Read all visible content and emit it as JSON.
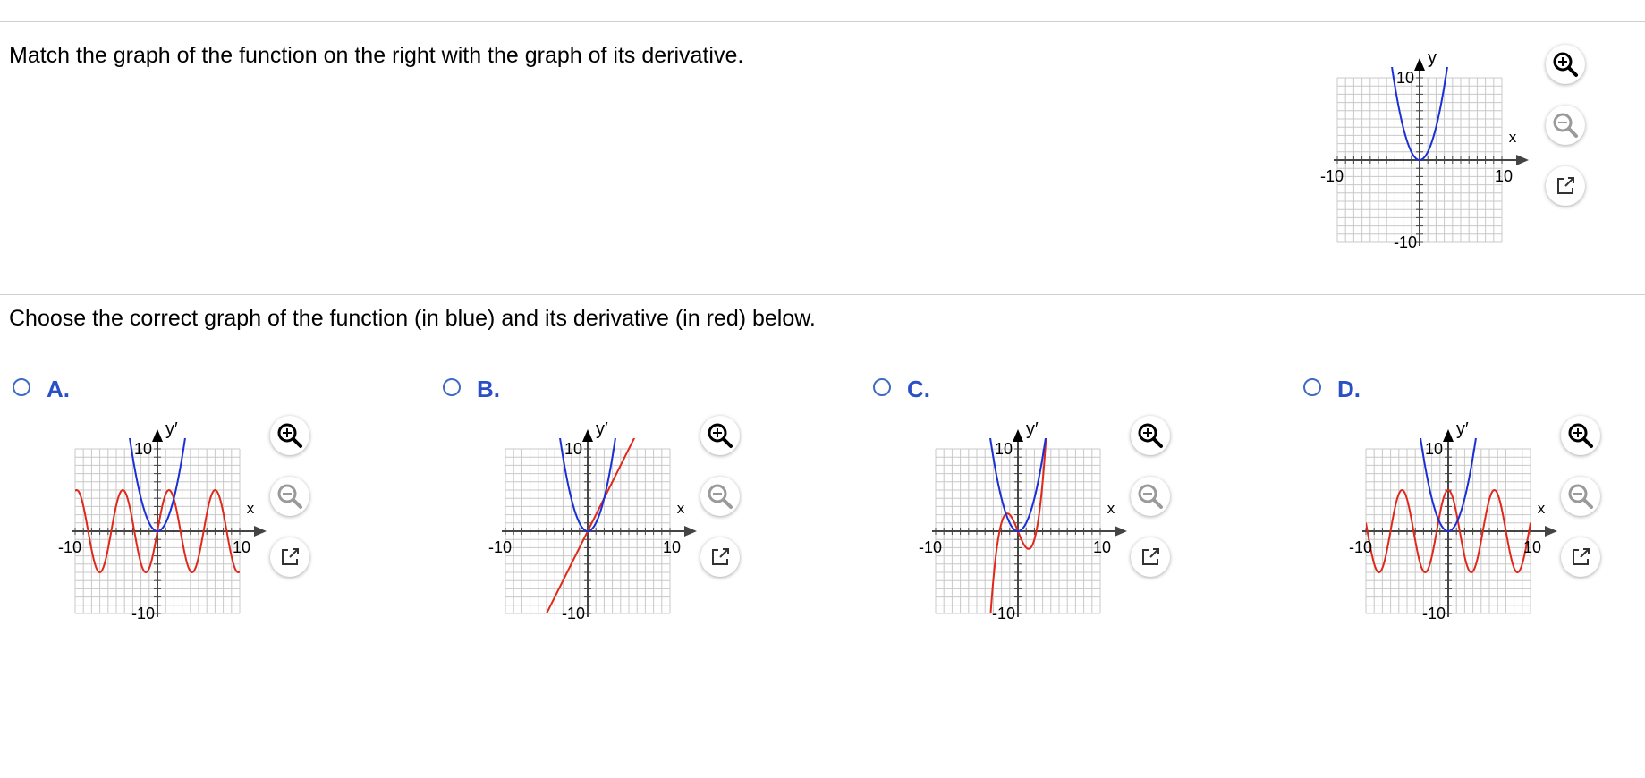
{
  "question": {
    "prompt": "Match the graph of the function on the right with the graph of its derivative.",
    "instruction": "Choose the correct graph of the function (in blue) and its derivative (in red) below."
  },
  "colors": {
    "function": "#1a2fd6",
    "derivative": "#e0281b",
    "option_label": "#2b4fc7",
    "grid": "#c8c8c8"
  },
  "main_graph": {
    "x_label": "x",
    "y_label": "y",
    "x_min_label": "-10",
    "x_max_label": "10",
    "y_max_label": "10",
    "y_min_label": "-10"
  },
  "options": [
    {
      "label": "A.",
      "y_label": "y′",
      "x_label": "x",
      "x_min_label": "-10",
      "x_max_label": "10",
      "y_max_label": "10",
      "y_min_label": "-10",
      "derivative_shape": "sine-wave"
    },
    {
      "label": "B.",
      "y_label": "y′",
      "x_label": "x",
      "x_min_label": "-10",
      "x_max_label": "10",
      "y_max_label": "10",
      "y_min_label": "-10",
      "derivative_shape": "line"
    },
    {
      "label": "C.",
      "y_label": "y′",
      "x_label": "x",
      "x_min_label": "-10",
      "x_max_label": "10",
      "y_max_label": "10",
      "y_min_label": "-10",
      "derivative_shape": "cubic"
    },
    {
      "label": "D.",
      "y_label": "y′",
      "x_label": "x",
      "x_min_label": "-10",
      "x_max_label": "10",
      "y_max_label": "10",
      "y_min_label": "-10",
      "derivative_shape": "cosine-wave"
    }
  ],
  "tools": {
    "zoom_in_icon": "zoom-in-icon",
    "zoom_out_icon": "zoom-out-icon",
    "popout_icon": "external-link-icon"
  }
}
